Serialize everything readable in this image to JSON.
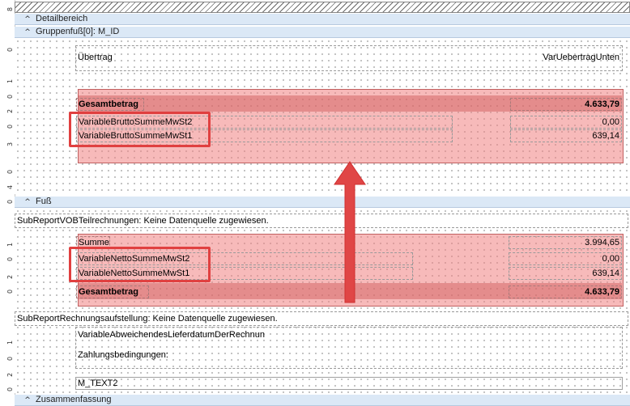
{
  "bands": {
    "detail": "Detailbereich",
    "group_footer": "Gruppenfuß[0]: M_ID",
    "footer": "Fuß",
    "summary": "Zusammenfassung"
  },
  "ruler_labels": [
    "8",
    "0",
    "1",
    "0",
    "2",
    "0",
    "3",
    "0",
    "4",
    "0",
    "1",
    "0",
    "2",
    "0",
    "1",
    "0",
    "2",
    "0"
  ],
  "group_footer": {
    "uebertrag_label": "Übertrag",
    "uebertrag_value": "VarUebertragUnten",
    "gesamtbetrag_label": "Gesamtbetrag",
    "gesamtbetrag_value": "4.633,79",
    "brutto_mwst2_label": "VariableBruttoSummeMwSt2",
    "brutto_mwst2_value": "0,00",
    "brutto_mwst1_label": "VariableBruttoSummeMwSt1",
    "brutto_mwst1_value": "639,14"
  },
  "footer": {
    "subreport_vob": "SubReportVOBTeilrechnungen: Keine Datenquelle zugewiesen.",
    "summe_label": "Summe",
    "summe_value": "3.994,65",
    "netto_mwst2_label": "VariableNettoSummeMwSt2",
    "netto_mwst2_value": "0,00",
    "netto_mwst1_label": "VariableNettoSummeMwSt1",
    "netto_mwst1_value": "639,14",
    "gesamtbetrag_label": "Gesamtbetrag",
    "gesamtbetrag_value": "4.633,79",
    "subreport_rechnung": "SubReportRechnungsaufstellung: Keine Datenquelle zugewiesen.",
    "abweichendes_lieferdatum": "VariableAbweichendesLieferdatumDerRechnun",
    "zahlungsbedingungen": "Zahlungsbedingungen:",
    "m_text2": "M_TEXT2"
  },
  "icons": {
    "band_toggle": "chevron-up-icon",
    "annotation": "up-arrow-icon"
  },
  "colors": {
    "band_bg": "#dbe8f6",
    "highlight": "#f08282",
    "annotation_red": "#e04040"
  }
}
